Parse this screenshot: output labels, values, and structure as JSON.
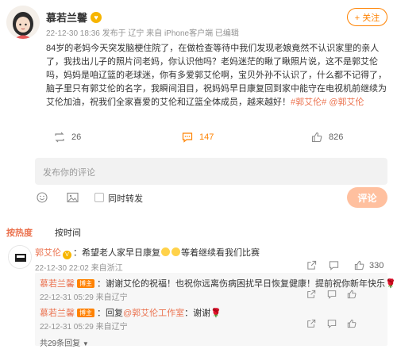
{
  "post": {
    "author": "慕若兰馨",
    "meta": "22-12-30 18:36 发布于 辽宁  来自 iPhone客户端  已编辑",
    "follow_label": "+ 关注",
    "text_main": "84岁的老妈今天突发脑梗住院了，在做检查等待中我们发现老娘竟然不认识家里的亲人了，我找出儿子的照片问老妈，你认识他吗？老妈迷茫的瞅了瞅照片说，这不是郭艾伦吗，妈妈是咱辽篮的老球迷，你有多爱郭艾伦啊，宝贝外孙不认识了，什么都不记得了，脑子里只有郭艾伦的名字，我瞬间泪目，祝妈妈早日康复回到家中能守在电视机前继续为艾伦加油，祝我们全家喜爱的艾伦和辽篮全体成员，越来越好！",
    "tag1": "#郭艾伦#",
    "tag2": "@郭艾伦"
  },
  "actions": {
    "repost_count": "26",
    "comment_count": "147",
    "like_count": "826"
  },
  "compose": {
    "placeholder": "发布你的评论",
    "repost_label": "同时转发",
    "submit_label": "评论"
  },
  "sort": {
    "hot": "按热度",
    "time": "按时间"
  },
  "comment": {
    "author": "郭艾伦",
    "text1": "：希望老人家早日康复",
    "text2": "等着继续看我们比赛",
    "meta": "22-12-30 22:02 来自浙江",
    "like_count": "330"
  },
  "replies": [
    {
      "author": "慕若兰馨",
      "badge": "博主",
      "text": "：谢谢艾伦的祝福！也祝你远离伤病困扰早日恢复健康！提前祝你新年快乐",
      "meta": "22-12-31 05:29 来自辽宁"
    },
    {
      "author": "慕若兰馨",
      "badge": "博主",
      "text_pre": "：回复",
      "mention": "@郭艾伦工作室",
      "text_post": "：谢谢",
      "meta": "22-12-31 05:29 来自辽宁"
    }
  ],
  "more_replies": "共29条回复",
  "colors": {
    "accent": "#ff8200",
    "link": "#eb7350",
    "muted": "#939393"
  }
}
